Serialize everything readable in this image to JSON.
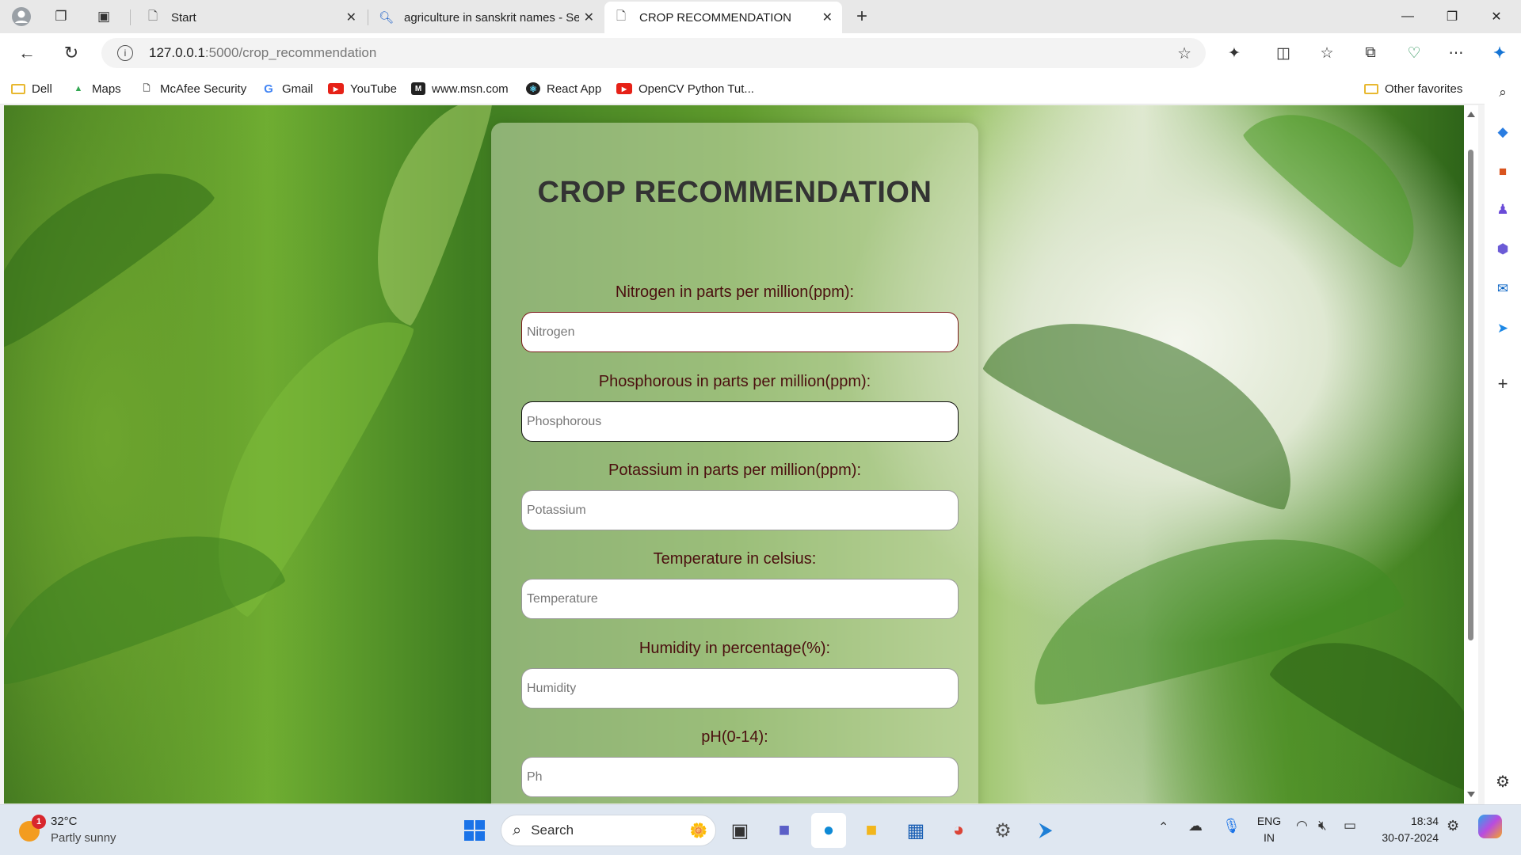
{
  "browser": {
    "tabs": [
      {
        "icon": "page-icon",
        "title": "Start"
      },
      {
        "icon": "search-icon",
        "title": "agriculture in sanskrit names - Se"
      },
      {
        "icon": "page-icon",
        "title": "CROP RECOMMENDATION"
      }
    ],
    "active_tab": 2,
    "url_host": "127.0.0.1",
    "url_path": ":5000/crop_recommendation",
    "favorites": [
      {
        "icon": "folder-icon",
        "label": "Dell",
        "color": "#e8b830"
      },
      {
        "icon": "maps-icon",
        "label": "Maps",
        "color": "#34a853"
      },
      {
        "icon": "page-icon",
        "label": "McAfee Security",
        "color": "#555555"
      },
      {
        "icon": "gmail-icon",
        "label": "Gmail",
        "color": "#ea4335"
      },
      {
        "icon": "youtube-icon",
        "label": "YouTube",
        "color": "#e62117"
      },
      {
        "icon": "msn-icon",
        "label": "www.msn.com",
        "color": "#222222"
      },
      {
        "icon": "react-icon",
        "label": "React App",
        "color": "#222222"
      },
      {
        "icon": "youtube-icon",
        "label": "OpenCV Python Tut...",
        "color": "#e62117"
      }
    ],
    "other_favorites": "Other favorites"
  },
  "page": {
    "title": "CROP RECOMMENDATION",
    "fields": [
      {
        "label": "Nitrogen in parts per million(ppm):",
        "placeholder": "Nitrogen"
      },
      {
        "label": "Phosphorous in parts per million(ppm):",
        "placeholder": "Phosphorous"
      },
      {
        "label": "Potassium in parts per million(ppm):",
        "placeholder": "Potassium"
      },
      {
        "label": "Temperature in celsius:",
        "placeholder": "Temperature"
      },
      {
        "label": "Humidity in percentage(%):",
        "placeholder": "Humidity"
      },
      {
        "label": "pH(0-14):",
        "placeholder": "Ph"
      }
    ]
  },
  "taskbar": {
    "weather_temp": "32°C",
    "weather_desc": "Partly sunny",
    "weather_badge": "1",
    "search_label": "Search",
    "lang_top": "ENG",
    "lang_bottom": "IN",
    "time": "18:34",
    "date": "30-07-2024"
  },
  "colors": {
    "label_text": "#4b0f0f",
    "input_border": "#7a1a1a",
    "title_text": "#333333"
  }
}
